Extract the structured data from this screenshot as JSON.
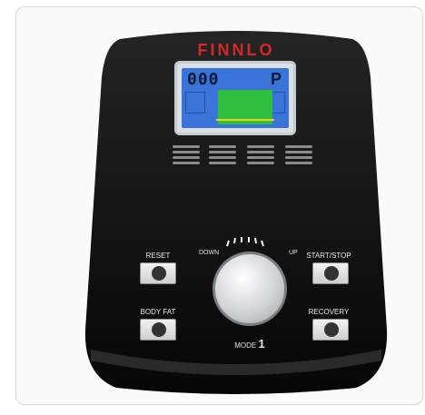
{
  "brand": "FINNLO",
  "display": {
    "digits": "000",
    "program": "P"
  },
  "controls": {
    "reset": "RESET",
    "start_stop": "START/STOP",
    "body_fat": "BODY FAT",
    "recovery": "RECOVERY",
    "dial_down": "DOWN",
    "dial_up": "UP",
    "mode_label": "MODE",
    "mode_value": "1"
  },
  "colors": {
    "console": "#121212",
    "lcd_blue": "#3a74d8",
    "lcd_green": "#2fbf3f",
    "brand_red": "#d62828"
  },
  "icons": {
    "reset": "reset-icon",
    "start_stop": "start-stop-icon",
    "body_fat": "body-fat-icon",
    "recovery": "recovery-icon"
  }
}
